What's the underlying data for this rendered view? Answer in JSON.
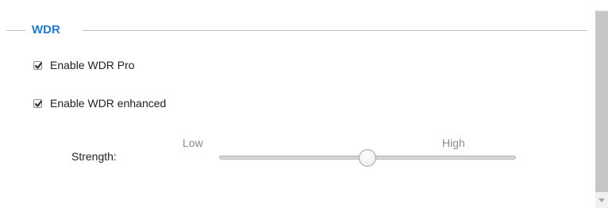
{
  "section": {
    "title": "WDR",
    "title_color": "#1f7bd8"
  },
  "options": [
    {
      "label": "Enable WDR Pro",
      "checked": true
    },
    {
      "label": "Enable WDR enhanced",
      "checked": true
    }
  ],
  "strength": {
    "label": "Strength:",
    "min_label": "Low",
    "max_label": "High",
    "level_fraction": 0.5
  },
  "scrollbar": {
    "down_icon": "chevron-down-icon"
  }
}
